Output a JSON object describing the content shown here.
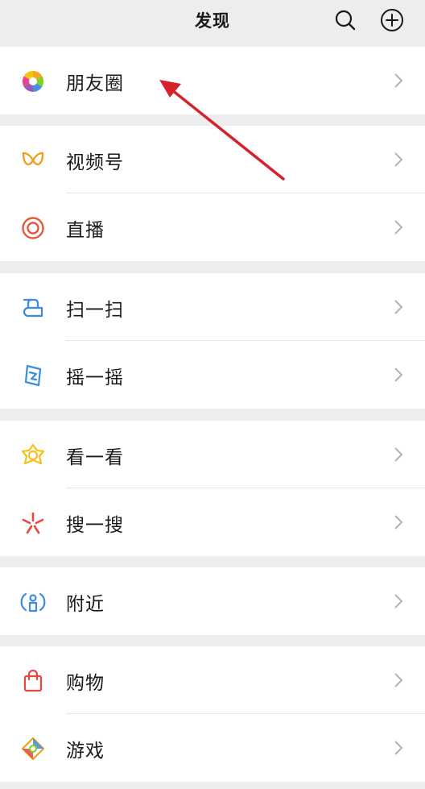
{
  "header": {
    "title": "发现",
    "search_icon": "search-icon",
    "add_icon": "add-icon"
  },
  "groups": [
    {
      "items": [
        {
          "label": "朋友圈",
          "icon": "moments-icon"
        }
      ]
    },
    {
      "items": [
        {
          "label": "视频号",
          "icon": "channels-icon"
        },
        {
          "label": "直播",
          "icon": "live-icon"
        }
      ]
    },
    {
      "items": [
        {
          "label": "扫一扫",
          "icon": "scan-icon"
        },
        {
          "label": "摇一摇",
          "icon": "shake-icon"
        }
      ]
    },
    {
      "items": [
        {
          "label": "看一看",
          "icon": "top-stories-icon"
        },
        {
          "label": "搜一搜",
          "icon": "search-search-icon"
        }
      ]
    },
    {
      "items": [
        {
          "label": "附近",
          "icon": "nearby-icon"
        }
      ]
    },
    {
      "items": [
        {
          "label": "购物",
          "icon": "shopping-icon"
        },
        {
          "label": "游戏",
          "icon": "games-icon"
        }
      ]
    }
  ],
  "colors": {
    "background": "#ededed",
    "row_background": "#ffffff",
    "text": "#191919",
    "chevron": "#b2b2b2",
    "annotation_arrow": "#d6202a"
  }
}
